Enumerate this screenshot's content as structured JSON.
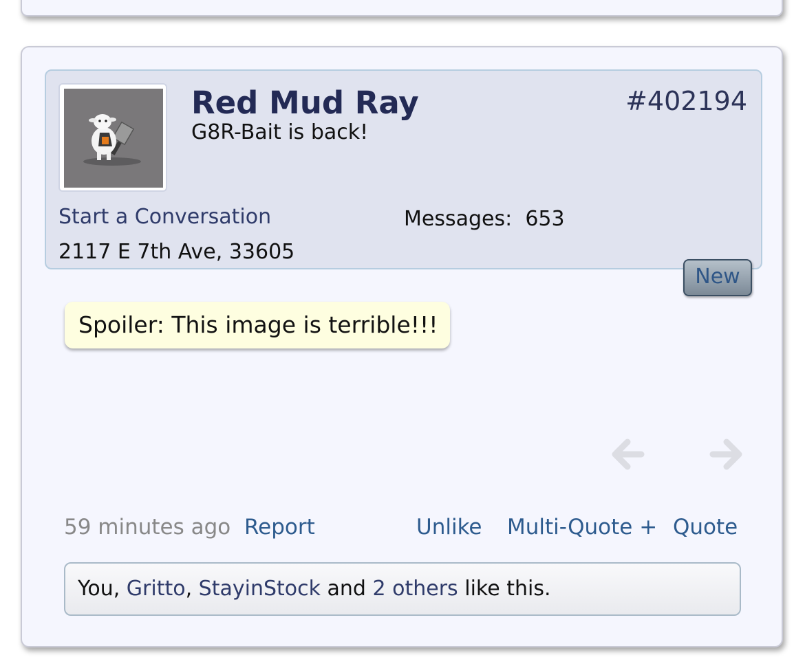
{
  "post": {
    "username": "Red Mud Ray",
    "user_title": "G8R-Bait is back!",
    "post_number": "#402194",
    "start_conversation": "Start a Conversation",
    "location": "2117 E 7th Ave, 33605",
    "messages_label": "Messages:",
    "messages_count": "653",
    "new_badge": "New",
    "spoiler_label": "Spoiler: This image is terrible!!!",
    "time": "59 minutes ago",
    "actions": {
      "report": "Report",
      "unlike": "Unlike",
      "multi_quote": "Multi-Quote +",
      "quote": "Quote"
    },
    "likes": {
      "you": "You",
      "sep1": ", ",
      "user1": "Gritto",
      "sep2": ", ",
      "user2": "StayinStock",
      "and": " and ",
      "others": "2 others",
      "suffix": " like this."
    }
  },
  "icons": {
    "avatar": "sheep-with-hammer-avatar",
    "prev": "arrow-left-icon",
    "next": "arrow-right-icon"
  },
  "colors": {
    "card_bg": "#f5f6fe",
    "user_block_bg": "#e0e3ef",
    "username": "#232a55",
    "link": "#2d5b8e",
    "spoiler_bg": "#fefee0",
    "arrow": "#dcdde3"
  }
}
